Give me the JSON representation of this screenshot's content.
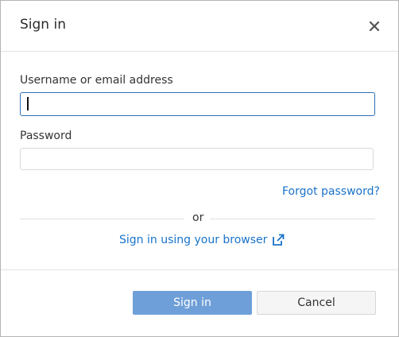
{
  "dialog": {
    "title": "Sign in"
  },
  "form": {
    "username_label": "Username or email address",
    "username_value": "",
    "password_label": "Password",
    "password_value": "",
    "forgot_link": "Forgot password?",
    "or_text": "or",
    "browser_link": "Sign in using your browser"
  },
  "footer": {
    "signin_label": "Sign in",
    "cancel_label": "Cancel"
  },
  "colors": {
    "accent": "#1a73c9",
    "focus_border": "#2e6fb6",
    "primary_button": "#6f9fd8"
  },
  "icons": {
    "close": "close-icon",
    "external": "external-link-icon"
  }
}
